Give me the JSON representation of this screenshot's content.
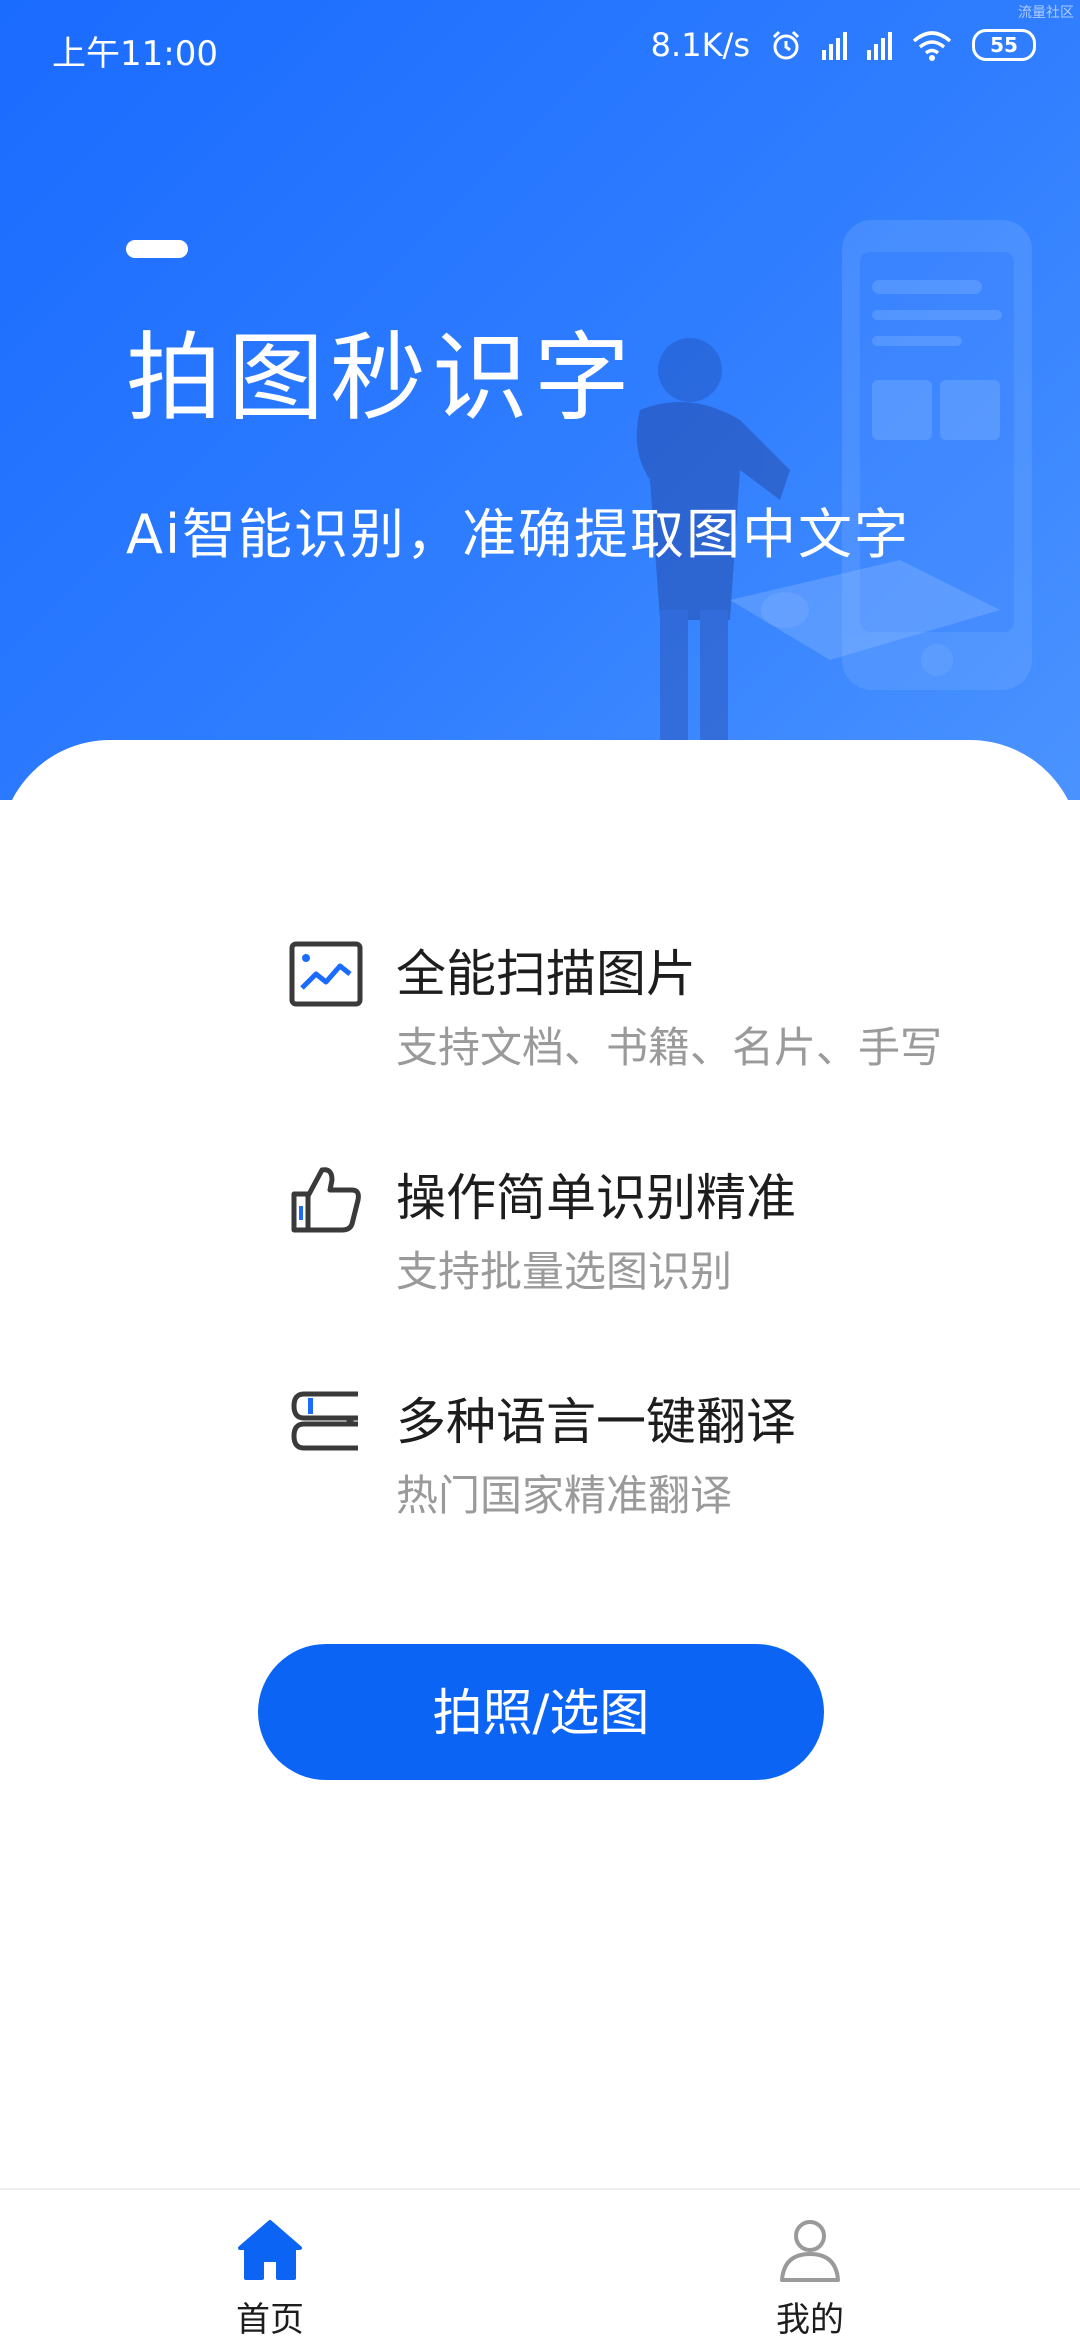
{
  "status_bar": {
    "time": "上午11:00",
    "network_speed": "8.1K/s",
    "battery": "55",
    "watermark": "流量社区",
    "icons": [
      "alarm-icon",
      "hd-signal-icon",
      "hd-signal-icon",
      "wifi-icon",
      "battery-icon"
    ]
  },
  "hero": {
    "title": "拍图秒识字",
    "subtitle": "Ai智能识别，准确提取图中文字"
  },
  "features": [
    {
      "icon": "image-chart-icon",
      "title": "全能扫描图片",
      "subtitle": "支持文档、书籍、名片、手写"
    },
    {
      "icon": "thumbs-up-icon",
      "title": "操作简单识别精准",
      "subtitle": "支持批量选图识别"
    },
    {
      "icon": "books-icon",
      "title": "多种语言一键翻译",
      "subtitle": "热门国家精准翻译"
    }
  ],
  "cta": {
    "label": "拍照/选图"
  },
  "bottom_nav": [
    {
      "label": "首页",
      "icon": "home-icon",
      "active": true
    },
    {
      "label": "我的",
      "icon": "user-icon",
      "active": false
    }
  ],
  "colors": {
    "primary": "#0c64f5",
    "hero_gradient_start": "#1a6bff",
    "hero_gradient_end": "#4a93ff",
    "text_primary": "#1d1d1d",
    "text_secondary": "#9a9a9a"
  }
}
